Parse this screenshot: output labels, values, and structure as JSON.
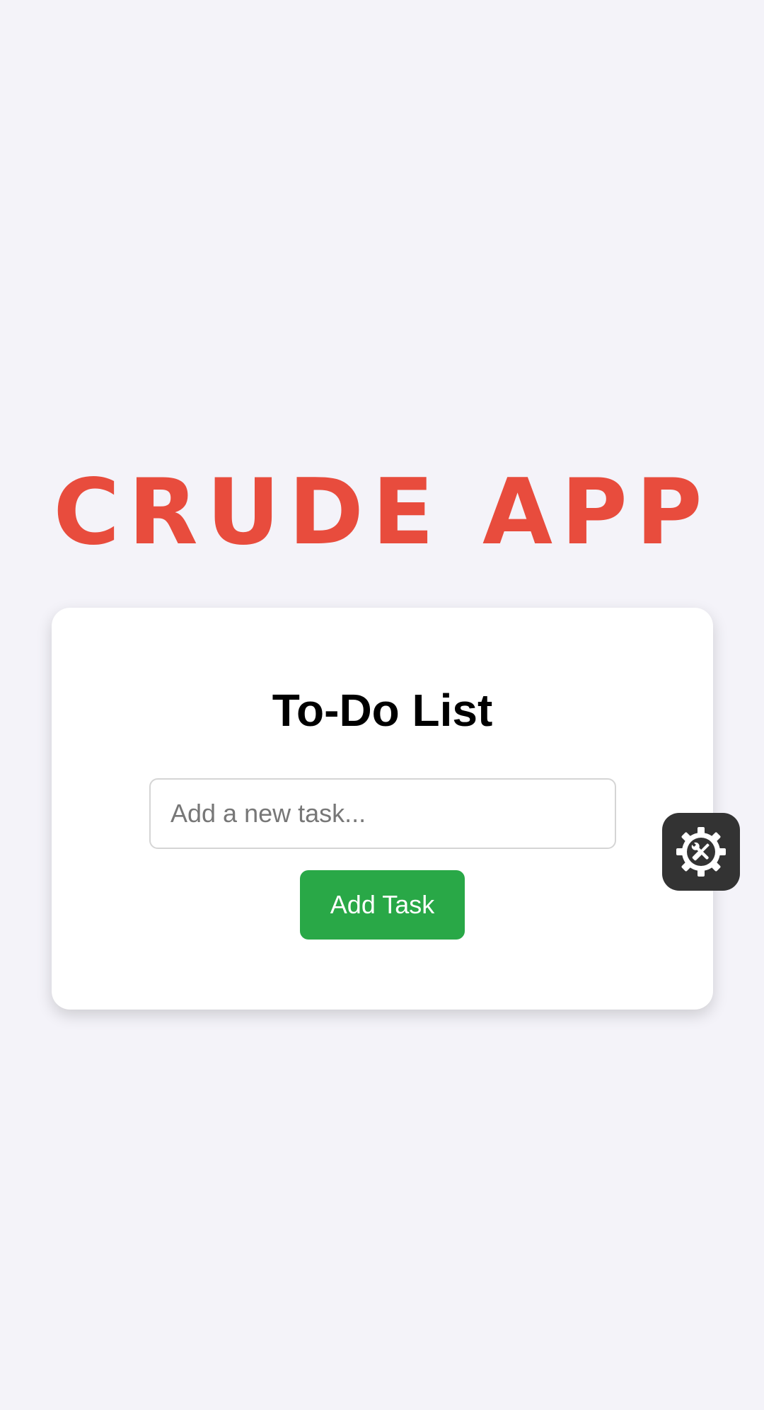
{
  "app": {
    "title": "CRUDE APP"
  },
  "todo": {
    "heading": "To-Do List",
    "input": {
      "placeholder": "Add a new task...",
      "value": ""
    },
    "add_button_label": "Add Task"
  },
  "floating_button": {
    "icon": "gear-tools-icon"
  },
  "colors": {
    "background": "#f4f3f9",
    "title": "#e84c3d",
    "card": "#ffffff",
    "button": "#29a847",
    "fab": "#333333"
  }
}
